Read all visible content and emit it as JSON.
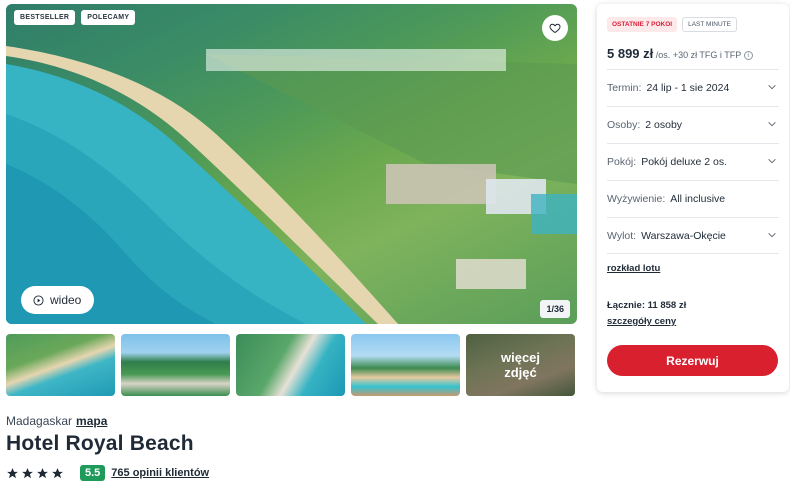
{
  "gallery": {
    "badges": [
      "BESTSELLER",
      "POLECAMY"
    ],
    "video_label": "wideo",
    "counter": "1/36",
    "more_photos_label": "więcej zdjęć"
  },
  "hotel": {
    "country": "Madagaskar",
    "map_link": "mapa",
    "name": "Hotel Royal Beach",
    "stars": 4,
    "score": "5.5",
    "reviews_link": "765 opinii klientów"
  },
  "offer": {
    "tags": [
      "OSTATNIE 7 POKOI",
      "LAST MINUTE"
    ],
    "price": "5 899 zł",
    "price_suffix": "/os.",
    "extra_fees": "+30 zł TFG i TFP",
    "rows": [
      {
        "label": "Termin:",
        "value": "24 lip - 1 sie 2024",
        "dropdown": true
      },
      {
        "label": "Osoby:",
        "value": "2 osoby",
        "dropdown": true
      },
      {
        "label": "Pokój:",
        "value": "Pokój deluxe 2 os.",
        "dropdown": true
      },
      {
        "label": "Wyżywienie:",
        "value": "All inclusive",
        "dropdown": false
      },
      {
        "label": "Wylot:",
        "value": "Warszawa-Okęcie",
        "dropdown": true
      }
    ],
    "flight_schedule_link": "rozkład lotu",
    "total_label": "Łącznie:",
    "total_value": "11 858 zł",
    "price_details_link": "szczegóły ceny",
    "reserve_button": "Rezerwuj"
  },
  "colors": {
    "accent_red": "#d8202f",
    "score_green": "#1e9b5a",
    "tag_red_text": "#d8203a"
  }
}
